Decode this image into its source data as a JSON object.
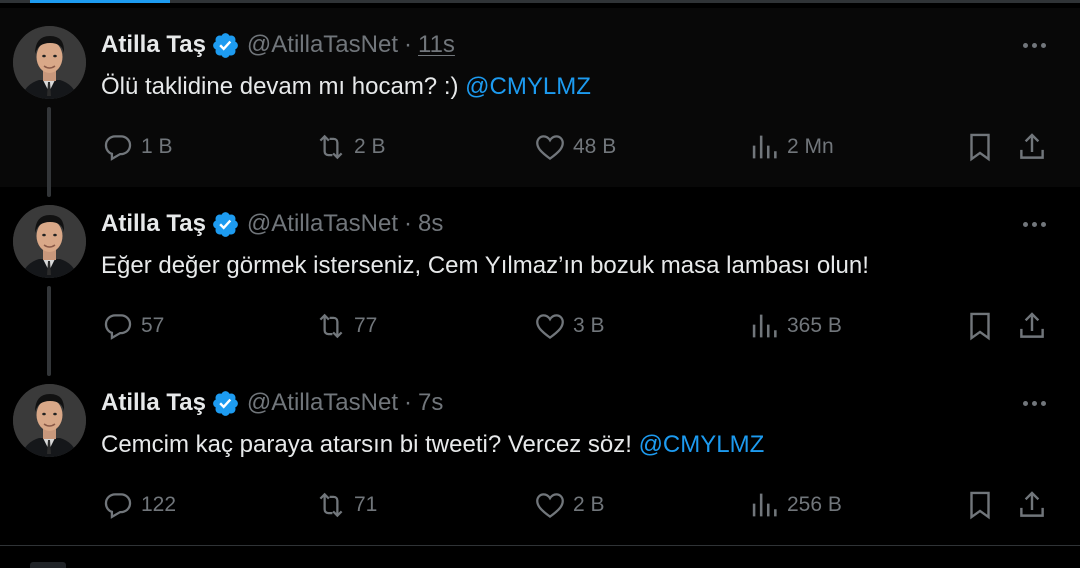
{
  "colors": {
    "background": "#000000",
    "highlight_row": "#080808",
    "text": "#e7e9ea",
    "muted": "#71767b",
    "accent": "#1d9bf0",
    "divider": "#2f3336"
  },
  "tweets": [
    {
      "name": "Atilla Taş",
      "handle": "@AtillaTasNet",
      "separator": "·",
      "time": "11s",
      "text": "Ölü taklidine devam mı hocam? :) ",
      "mention": "@CMYLMZ",
      "replies": "1 B",
      "retweets": "2 B",
      "likes": "48 B",
      "views": "2 Mn"
    },
    {
      "name": "Atilla Taş",
      "handle": "@AtillaTasNet",
      "separator": "·",
      "time": "8s",
      "text": "Eğer değer görmek isterseniz, Cem Yılmaz’ın bozuk masa lambası olun!",
      "mention": "",
      "replies": "57",
      "retweets": "77",
      "likes": "3 B",
      "views": "365 B"
    },
    {
      "name": "Atilla Taş",
      "handle": "@AtillaTasNet",
      "separator": "·",
      "time": "7s",
      "text": "Cemcim kaç paraya atarsın bi tweeti? Vercez söz! ",
      "mention": "@CMYLMZ",
      "replies": "122",
      "retweets": "71",
      "likes": "2 B",
      "views": "256 B"
    }
  ],
  "icons": {
    "avatar": "profile-photo",
    "verified": "verified-badge-icon",
    "more": "more-options-icon",
    "reply": "reply-bubble-icon",
    "retweet": "retweet-arrows-icon",
    "like": "heart-icon",
    "views": "bar-chart-icon",
    "bookmark": "bookmark-icon",
    "share": "share-upload-icon"
  }
}
